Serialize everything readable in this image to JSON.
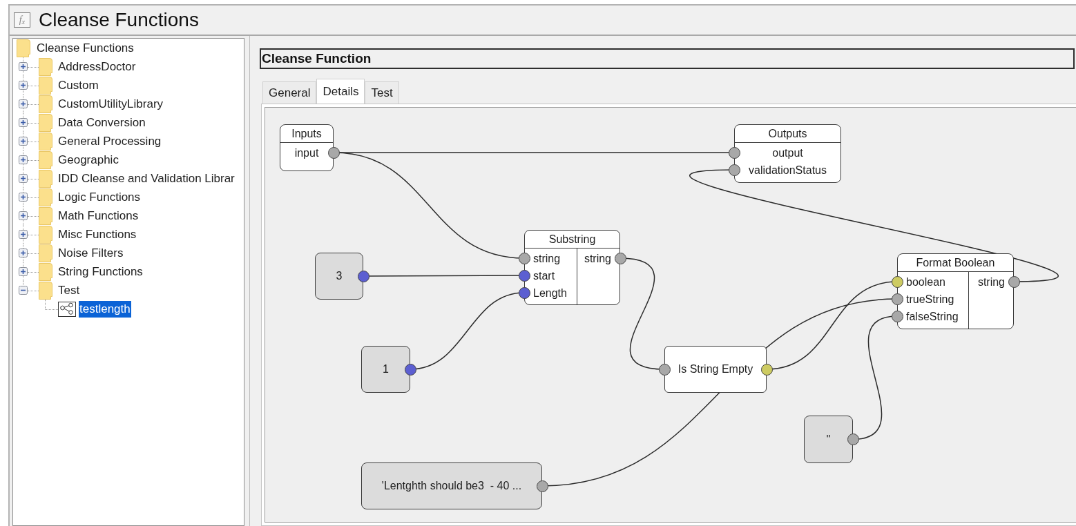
{
  "window": {
    "icon_label": "f$_{x}$",
    "title": "Cleanse Functions"
  },
  "tree": {
    "label": "Cleanse Functions",
    "kind": "folder",
    "selected": false,
    "children": [
      {
        "label": "AddressDoctor",
        "kind": "folder",
        "expanded": false,
        "selected": false
      },
      {
        "label": "Custom",
        "kind": "folder",
        "expanded": false,
        "selected": false
      },
      {
        "label": "CustomUtilityLibrary",
        "kind": "folder",
        "expanded": false,
        "selected": false
      },
      {
        "label": "Data Conversion",
        "kind": "folder",
        "expanded": false,
        "selected": false
      },
      {
        "label": "General Processing",
        "kind": "folder",
        "expanded": false,
        "selected": false
      },
      {
        "label": "Geographic",
        "kind": "folder",
        "expanded": false,
        "selected": false
      },
      {
        "label": "IDD Cleanse and Validation Librar",
        "kind": "folder",
        "expanded": false,
        "selected": false
      },
      {
        "label": "Logic Functions",
        "kind": "folder",
        "expanded": false,
        "selected": false
      },
      {
        "label": "Math Functions",
        "kind": "folder",
        "expanded": false,
        "selected": false
      },
      {
        "label": "Misc Functions",
        "kind": "folder",
        "expanded": false,
        "selected": false
      },
      {
        "label": "Noise Filters",
        "kind": "folder",
        "expanded": false,
        "selected": false
      },
      {
        "label": "String Functions",
        "kind": "folder",
        "expanded": false,
        "selected": false
      },
      {
        "label": "Test",
        "kind": "folder",
        "expanded": true,
        "selected": false,
        "children": [
          {
            "label": "testlength",
            "kind": "function",
            "selected": true
          }
        ]
      }
    ]
  },
  "detail": {
    "title": "Cleanse Function",
    "tabs": [
      {
        "label": "General",
        "selected": false
      },
      {
        "label": "Details",
        "selected": true
      },
      {
        "label": "Test",
        "selected": false
      }
    ],
    "diagram": {
      "nodes": [
        {
          "kind": "io",
          "title": "Inputs",
          "outputs": [
            {
              "label": "input",
              "color": "#a8a8a8"
            }
          ]
        },
        {
          "kind": "io",
          "title": "Outputs",
          "inputs": [
            {
              "label": "output",
              "color": "#a8a8a8"
            },
            {
              "label": "validationStatus",
              "color": "#a8a8a8"
            }
          ]
        },
        {
          "kind": "function",
          "title": "Substring",
          "inputs": [
            {
              "label": "string",
              "color": "#a8a8a8"
            },
            {
              "label": "start",
              "color": "#5c5fd1"
            },
            {
              "label": "Length",
              "color": "#5c5fd1"
            }
          ],
          "outputs": [
            {
              "label": "string",
              "color": "#a8a8a8"
            }
          ]
        },
        {
          "kind": "constant",
          "value": "3",
          "outputs": [
            {
              "color": "#5c5fd1"
            }
          ]
        },
        {
          "kind": "constant",
          "value": "1",
          "outputs": [
            {
              "color": "#5c5fd1"
            }
          ]
        },
        {
          "kind": "step",
          "title": "Is String Empty",
          "inputs": [
            {
              "color": "#a8a8a8"
            }
          ],
          "outputs": [
            {
              "color": "#cdcb62"
            }
          ]
        },
        {
          "kind": "function",
          "title": "Format Boolean",
          "inputs": [
            {
              "label": "boolean",
              "color": "#cdcb62"
            },
            {
              "label": "trueString",
              "color": "#a8a8a8"
            },
            {
              "label": "falseString",
              "color": "#a8a8a8"
            }
          ],
          "outputs": [
            {
              "label": "string",
              "color": "#a8a8a8"
            }
          ]
        },
        {
          "kind": "constant",
          "value": "''",
          "outputs": [
            {
              "color": "#a8a8a8"
            }
          ]
        },
        {
          "kind": "constant",
          "value": "'Lentghth should be3  - 40 ...",
          "outputs": [
            {
              "color": "#a8a8a8"
            }
          ]
        }
      ]
    }
  }
}
